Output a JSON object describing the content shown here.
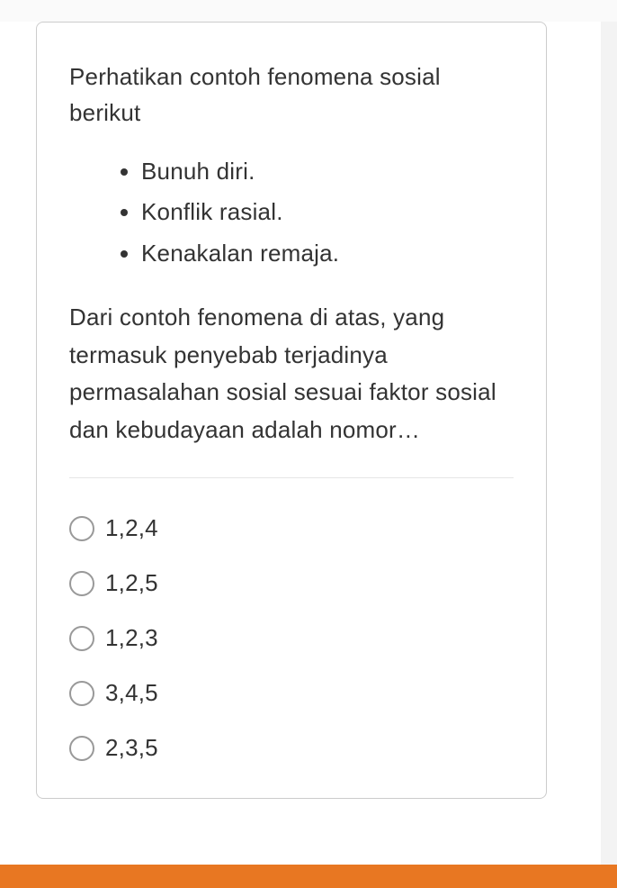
{
  "question": {
    "intro": "Perhatikan contoh fenomena sosial berikut",
    "bullets": [
      "Bunuh diri.",
      "Konflik rasial.",
      "Kenakalan remaja."
    ],
    "body": "Dari contoh fenomena di atas, yang termasuk penyebab terjadinya permasalahan sosial sesuai faktor sosial dan kebudayaan adalah nomor…"
  },
  "options": [
    {
      "label": "1,2,4"
    },
    {
      "label": "1,2,5"
    },
    {
      "label": "1,2,3"
    },
    {
      "label": "3,4,5"
    },
    {
      "label": "2,3,5"
    }
  ],
  "colors": {
    "accent": "#e87722"
  }
}
